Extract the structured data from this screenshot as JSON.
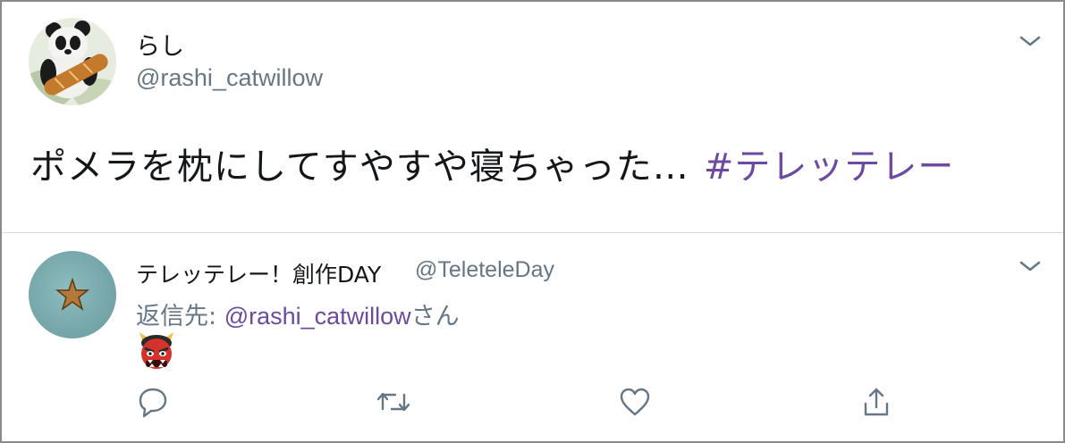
{
  "main_tweet": {
    "author": {
      "display_name": "らし",
      "handle": "@rashi_catwillow",
      "avatar_icon": "panda-avatar-icon"
    },
    "text": "ポメラを枕にしてすやすや寝ちゃった…",
    "hashtag": "#テレッテレー",
    "menu_icon": "chevron-down-icon"
  },
  "reply_tweet": {
    "author": {
      "display_name": "テレッテレー！創作DAY",
      "handle": "@TeleteleDay",
      "avatar_icon": "starfish-avatar-icon"
    },
    "reply_to_label": "返信先:",
    "reply_to_mention": "@rashi_catwillow",
    "reply_to_suffix": "さん",
    "body_emoji": "japanese-ogre-emoji-icon",
    "menu_icon": "chevron-down-icon",
    "actions": [
      "reply-icon",
      "retweet-icon",
      "like-heart-icon",
      "share-icon"
    ]
  },
  "colors": {
    "text_primary": "#14171a",
    "text_secondary": "#657786",
    "hashtag": "#6b4aa0",
    "border": "#8a8a8a",
    "divider": "#d9d9d9"
  }
}
